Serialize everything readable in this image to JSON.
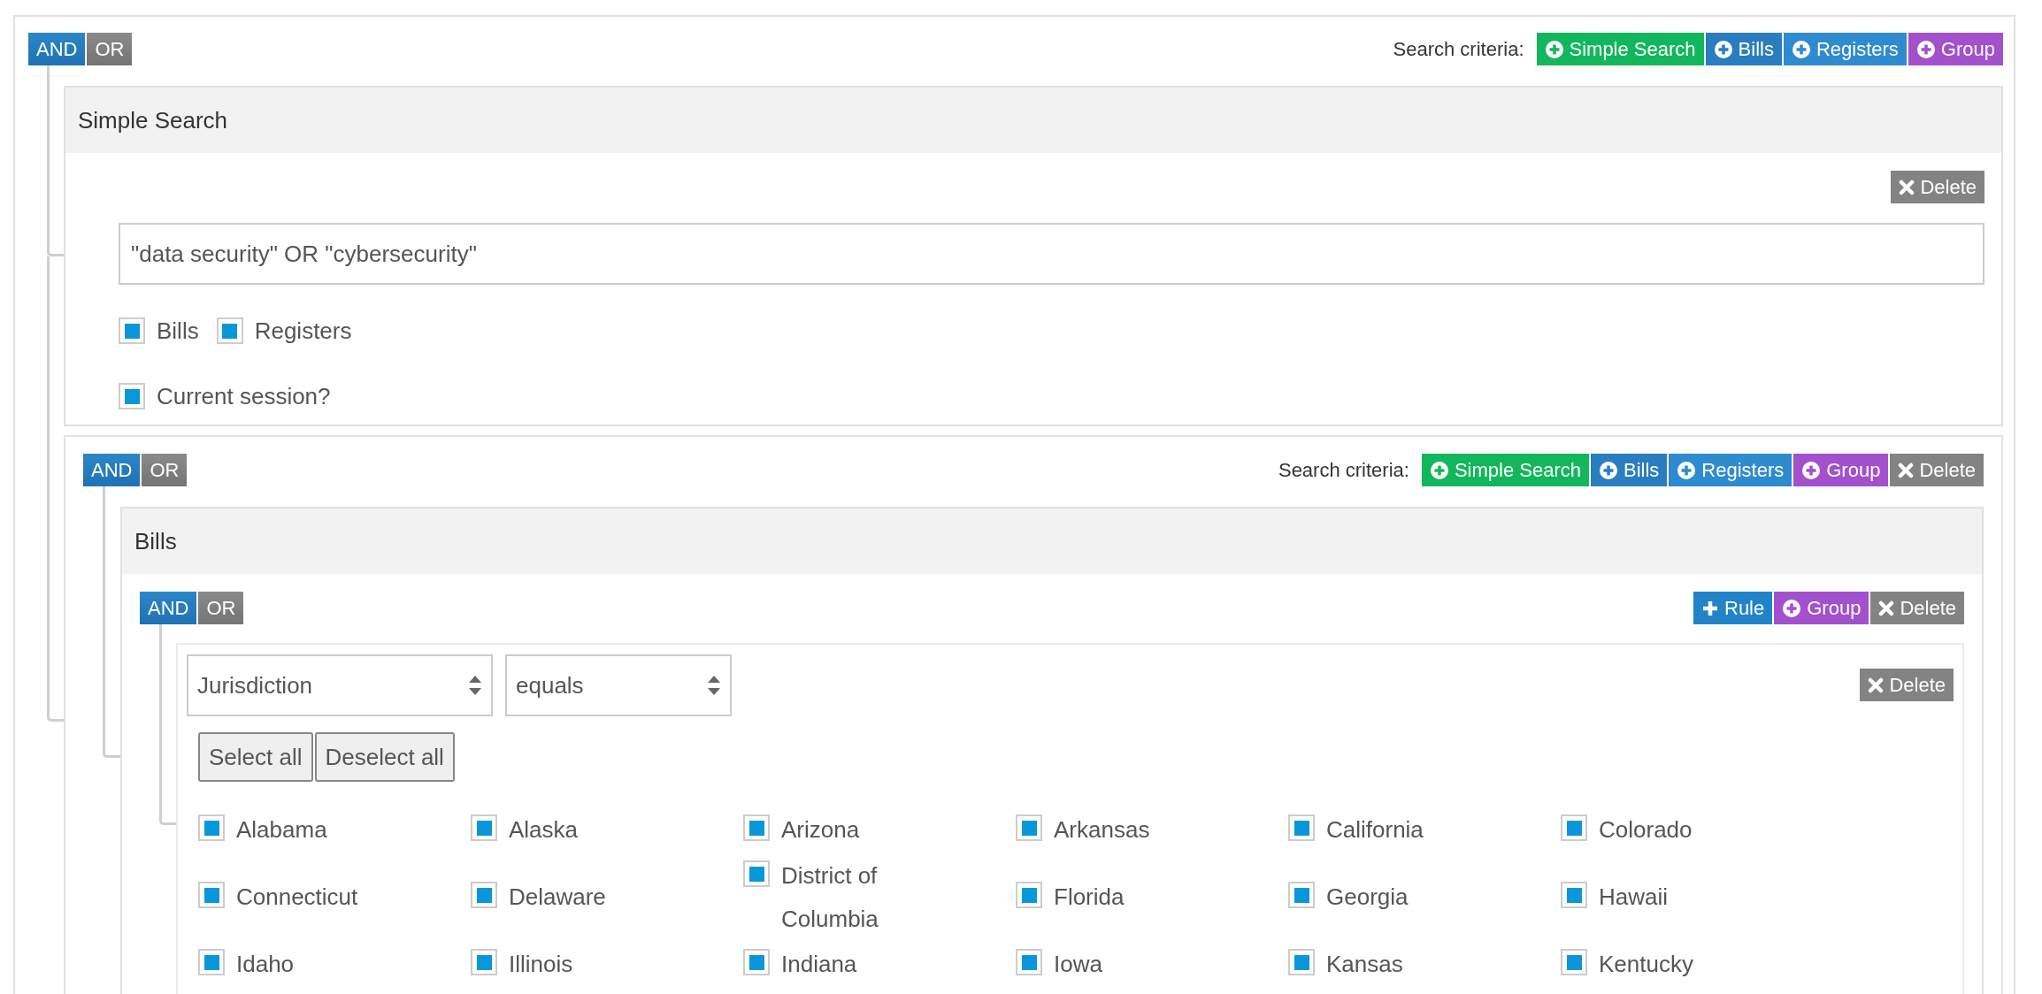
{
  "root": {
    "conditions": [
      {
        "label": "AND",
        "selected": true
      },
      {
        "label": "OR",
        "selected": false
      }
    ],
    "criteria_label": "Search criteria:",
    "criteria_buttons": [
      {
        "kind": "simple",
        "label": "Simple Search"
      },
      {
        "kind": "bills",
        "label": "Bills"
      },
      {
        "kind": "registers",
        "label": "Registers"
      },
      {
        "kind": "group",
        "label": "Group"
      }
    ],
    "children": [
      {
        "kind": "simple_search",
        "title": "Simple Search",
        "delete": "Delete",
        "query": "\"data security\" OR \"cybersecurity\"",
        "sources": [
          {
            "label": "Bills",
            "checked": true
          },
          {
            "label": "Registers",
            "checked": true
          }
        ],
        "session": {
          "label": "Current session?",
          "checked": true
        }
      },
      {
        "kind": "group",
        "conditions": [
          {
            "label": "AND",
            "selected": true
          },
          {
            "label": "OR",
            "selected": false
          }
        ],
        "criteria_label": "Search criteria:",
        "criteria_buttons": [
          {
            "kind": "simple",
            "label": "Simple Search"
          },
          {
            "kind": "bills",
            "label": "Bills"
          },
          {
            "kind": "registers",
            "label": "Registers"
          },
          {
            "kind": "group",
            "label": "Group"
          },
          {
            "kind": "delete",
            "label": "Delete"
          }
        ],
        "children": [
          {
            "kind": "bills",
            "title": "Bills",
            "conditions": [
              {
                "label": "AND",
                "selected": true
              },
              {
                "label": "OR",
                "selected": false
              }
            ],
            "buttons": [
              {
                "kind": "rule",
                "label": "Rule"
              },
              {
                "kind": "group",
                "label": "Group"
              },
              {
                "kind": "delete",
                "label": "Delete"
              }
            ],
            "rules": [
              {
                "field": "Jurisdiction",
                "operator": "equals",
                "delete": "Delete",
                "select_all": "Select all",
                "deselect_all": "Deselect all",
                "values": [
                  {
                    "label": "Alabama",
                    "checked": true
                  },
                  {
                    "label": "Alaska",
                    "checked": true
                  },
                  {
                    "label": "Arizona",
                    "checked": true
                  },
                  {
                    "label": "Arkansas",
                    "checked": true
                  },
                  {
                    "label": "California",
                    "checked": true
                  },
                  {
                    "label": "Colorado",
                    "checked": true
                  },
                  {
                    "label": "Connecticut",
                    "checked": true
                  },
                  {
                    "label": "Delaware",
                    "checked": true
                  },
                  {
                    "label": "District of Columbia",
                    "checked": true
                  },
                  {
                    "label": "Florida",
                    "checked": true
                  },
                  {
                    "label": "Georgia",
                    "checked": true
                  },
                  {
                    "label": "Hawaii",
                    "checked": true
                  },
                  {
                    "label": "Idaho",
                    "checked": true
                  },
                  {
                    "label": "Illinois",
                    "checked": true
                  },
                  {
                    "label": "Indiana",
                    "checked": true
                  },
                  {
                    "label": "Iowa",
                    "checked": true
                  },
                  {
                    "label": "Kansas",
                    "checked": true
                  },
                  {
                    "label": "Kentucky",
                    "checked": true
                  }
                ]
              }
            ]
          }
        ]
      }
    ]
  }
}
